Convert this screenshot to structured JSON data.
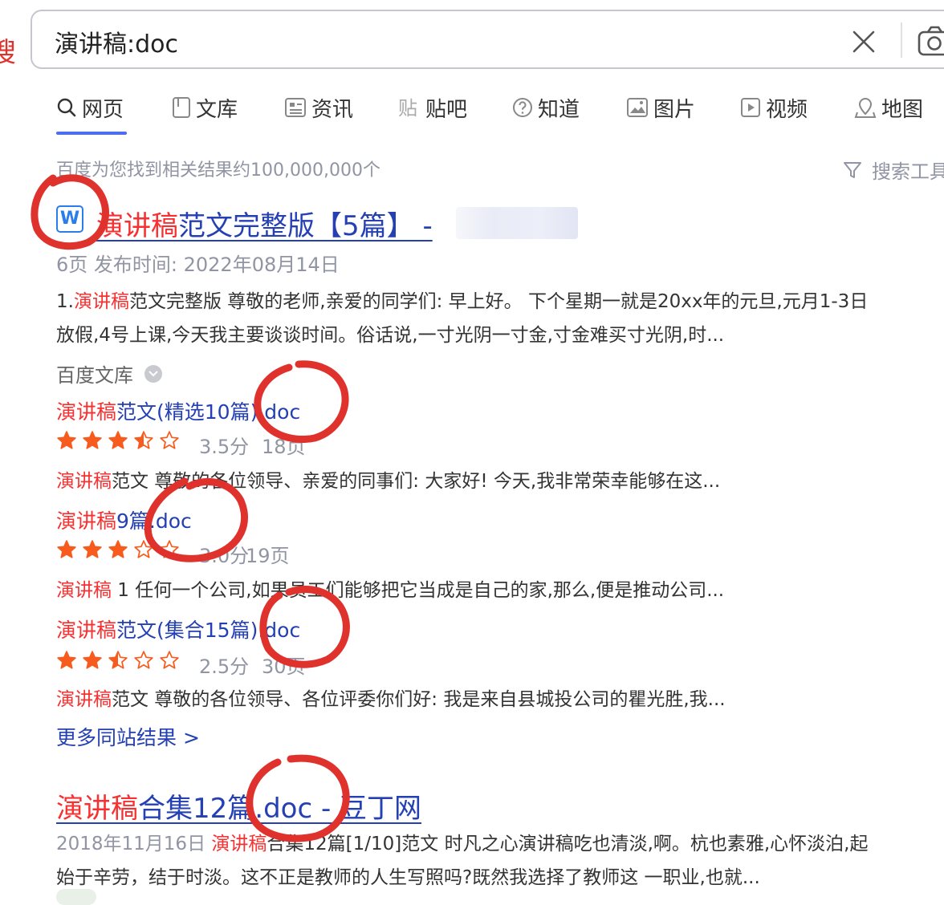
{
  "edge_mark": "搜",
  "search": {
    "query": "演讲稿:doc"
  },
  "icons": {
    "clear": "close-icon",
    "camera": "camera-icon",
    "doc": "word-doc-icon",
    "filter": "filter-icon"
  },
  "tabs": [
    {
      "label": "网页",
      "icon": "search-icon",
      "active": true
    },
    {
      "label": "文库",
      "icon": "library-icon"
    },
    {
      "label": "资讯",
      "icon": "news-icon"
    },
    {
      "label": "贴吧",
      "icon": "tieba-icon"
    },
    {
      "label": "知道",
      "icon": "question-icon"
    },
    {
      "label": "图片",
      "icon": "image-icon"
    },
    {
      "label": "视频",
      "icon": "video-icon"
    },
    {
      "label": "地图",
      "icon": "map-icon"
    }
  ],
  "result_count": "百度为您找到相关结果约100,000,000个",
  "search_tools": "搜索工具",
  "result1": {
    "doc_icon_letter": "W",
    "title_em": "演讲稿",
    "title_rest": "范文完整版【5篇】 - ",
    "meta": "6页 发布时间: 2022年08月14日",
    "snippet_line1_prefix": "1.",
    "snippet_line1_em": "演讲稿",
    "snippet_line1_rest": "范文完整版 尊敬的老师,亲爱的同学们: 早上好。 下个星期一就是20xx年的元旦,元月1-3日",
    "snippet_line2": "放假,4号上课,今天我主要谈谈时间。俗话说,一寸光阴一寸金,寸金难买寸光阴,时...",
    "source": "百度文库",
    "sub_results": [
      {
        "title_em": "演讲稿",
        "title_rest": "范文(精选10篇).doc",
        "rating": 3.5,
        "rating_text": "3.5分",
        "pages": "18页",
        "snippet_em": "演讲稿",
        "snippet_rest": "范文 尊敬的各位领导、亲爱的同事们: 大家好! 今天,我非常荣幸能够在这..."
      },
      {
        "title_em": "演讲稿",
        "title_rest": "9篇.doc",
        "rating": 3.0,
        "rating_text": "3.0分",
        "pages": "19页",
        "snippet_em": "演讲稿",
        "snippet_rest": " 1 任何一个公司,如果员工们能够把它当成是自己的家,那么,便是推动公司..."
      },
      {
        "title_em": "演讲稿",
        "title_rest": "范文(集合15篇).doc",
        "rating": 2.5,
        "rating_text": "2.5分",
        "pages": "30页",
        "snippet_em": "演讲稿",
        "snippet_rest": "范文 尊敬的各位领导、各位评委你们好: 我是来自县城投公司的瞿光胜,我..."
      }
    ],
    "more_results": "更多同站结果 >"
  },
  "result2": {
    "title_em": "演讲稿",
    "title_rest": "合集12篇.doc - 豆丁网",
    "date": "2018年11月16日",
    "snippet_em": "演讲稿",
    "snippet_rest": "合集12篇[1/10]范文 时凡之心演讲稿吃也清淡,啊。杭也素雅,心怀淡泊,起",
    "snippet_line2": "始于辛劳，结于时淡。这不正是教师的人生写照吗?既然我选择了教师这 一职业,也就..."
  },
  "colors": {
    "link": "#2440b3",
    "highlight": "#f73131",
    "accent": "#4e6ef2",
    "annotation": "#e0322d",
    "meta": "#9195a3"
  }
}
